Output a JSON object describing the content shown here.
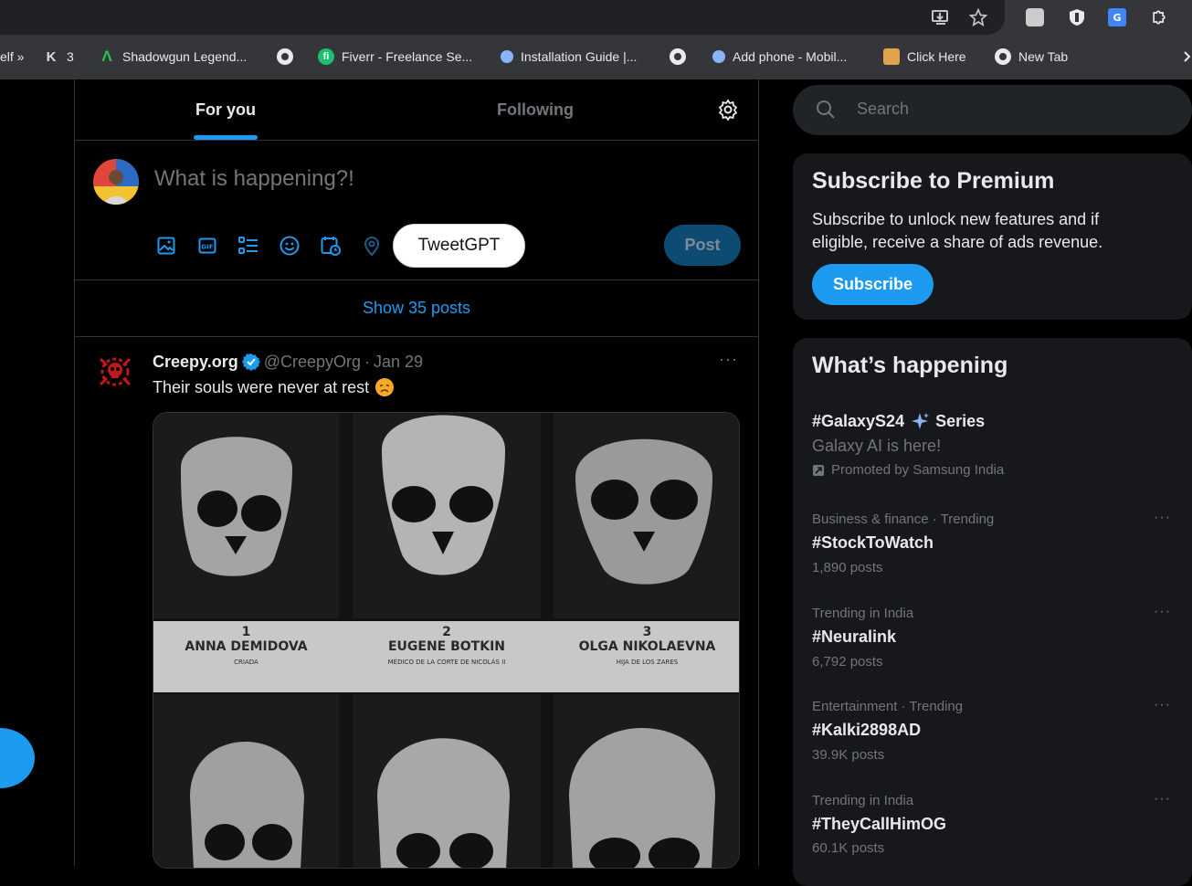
{
  "bookmarks": [
    {
      "label": "elf »",
      "icon": "overflow"
    },
    {
      "label": "3",
      "icon": "k-logo"
    },
    {
      "label": "Shadowgun Legend...",
      "icon": "shadowgun-logo"
    },
    {
      "label": "",
      "icon": "globe-icon"
    },
    {
      "label": "Fiverr - Freelance Se...",
      "icon": "fiverr-logo"
    },
    {
      "label": "Installation Guide |...",
      "icon": "site-logo"
    },
    {
      "label": "",
      "icon": "globe-icon"
    },
    {
      "label": "Add phone - Mobil...",
      "icon": "site-logo"
    },
    {
      "label": "Click Here",
      "icon": "wizard-logo"
    },
    {
      "label": "New Tab",
      "icon": "globe-icon"
    }
  ],
  "timeline": {
    "tabs": [
      {
        "label": "For you",
        "active": true
      },
      {
        "label": "Following",
        "active": false
      }
    ],
    "composer": {
      "placeholder": "What is happening?!",
      "tweetgpt_label": "TweetGPT",
      "post_label": "Post"
    },
    "show_posts": "Show 35 posts",
    "tweet": {
      "name": "Creepy.org",
      "handle": "@CreepyOrg",
      "dot": "·",
      "date": "Jan 29",
      "text": "Their souls were never at rest",
      "media_labels": [
        {
          "num": "1",
          "name": "ANNA DEMIDOVA",
          "sub": "CRIADA"
        },
        {
          "num": "2",
          "name": "EUGENE BOTKIN",
          "sub": "MÉDICO DE LA CORTE DE NICOLÁS II"
        },
        {
          "num": "3",
          "name": "OLGA NIKOLAEVNA",
          "sub": "HIJA DE LOS ZARES"
        }
      ]
    }
  },
  "sidebar": {
    "search_placeholder": "Search",
    "premium": {
      "title": "Subscribe to Premium",
      "body": "Subscribe to unlock new features and if eligible, receive a share of ads revenue.",
      "button": "Subscribe"
    },
    "trends_title": "What’s happening",
    "promoted": {
      "name": "#GalaxyS24",
      "suffix": "Series",
      "tagline": "Galaxy AI is here!",
      "promoter": "Promoted by Samsung India"
    },
    "trends": [
      {
        "meta": "Business & finance · Trending",
        "name": "#StockToWatch",
        "count": "1,890 posts"
      },
      {
        "meta": "Trending in India",
        "name": "#Neuralink",
        "count": "6,792 posts"
      },
      {
        "meta": "Entertainment · Trending",
        "name": "#Kalki2898AD",
        "count": "39.9K posts"
      },
      {
        "meta": "Trending in India",
        "name": "#TheyCallHimOG",
        "count": "60.1K posts"
      }
    ],
    "more_glyph": "···"
  },
  "colors": {
    "accent": "#1d9bf0",
    "background": "#000000",
    "card": "#16181c",
    "muted": "#71767b"
  }
}
